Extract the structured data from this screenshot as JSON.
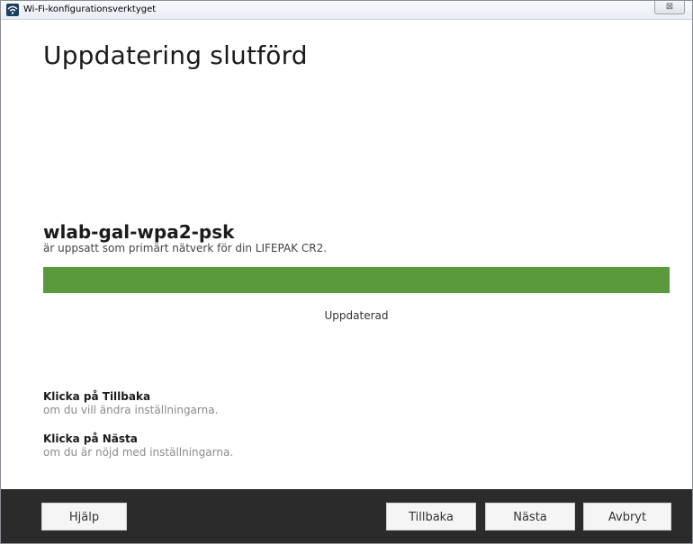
{
  "window": {
    "title": "Wi-Fi-konfigurationsverktyget",
    "close_glyph": "⊠"
  },
  "main": {
    "heading": "Uppdatering slutförd",
    "network_name": "wlab-gal-wpa2-psk",
    "network_desc": "är uppsatt som primärt nätverk för din LIFEPAK CR2.",
    "progress_percent": 100,
    "progress_status": "Uppdaterad",
    "progress_color": "#5a9a3c"
  },
  "instructions": [
    {
      "title": "Klicka på Tillbaka",
      "sub": "om du vill ändra inställningarna."
    },
    {
      "title": "Klicka på Nästa",
      "sub": "om du är nöjd med inställningarna."
    }
  ],
  "footer": {
    "help_label": "Hjälp",
    "back_label": "Tillbaka",
    "next_label": "Nästa",
    "cancel_label": "Avbryt"
  },
  "icons": {
    "title_icon": "wifi-icon",
    "close_icon": "close-icon"
  }
}
